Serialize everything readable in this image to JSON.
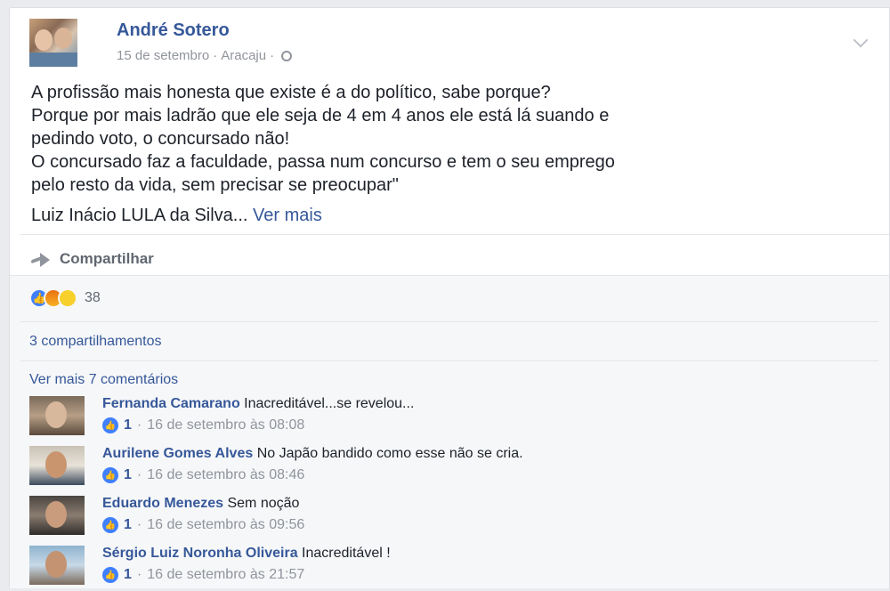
{
  "post": {
    "author": "André Sotero",
    "date": "15 de setembro",
    "location": "Aracaju",
    "separator": "·",
    "lines": [
      "A profissão mais honesta que existe é a do político, sabe porque?",
      "Porque por mais ladrão que ele seja de 4 em 4 anos ele está lá suando e",
      "pedindo voto, o concursado não!",
      "O concursado faz a faculdade, passa num concurso e tem o seu emprego",
      "pelo resto da vida, sem precisar se preocupar\""
    ],
    "signature": "Luiz Inácio LULA da Silva...",
    "see_more": "Ver mais"
  },
  "actions": {
    "share_label": "Compartilhar"
  },
  "feedback": {
    "reaction_count": "38",
    "reaction_icons": [
      "like-icon",
      "angry-icon",
      "wow-icon"
    ],
    "shares_label": "3 compartilhamentos",
    "more_comments_label": "Ver mais 7 comentários"
  },
  "comments": [
    {
      "author": "Fernanda Camarano",
      "text": "Inacreditável...se revelou...",
      "likes": "1",
      "meta": "16 de setembro às 08:08"
    },
    {
      "author": "Aurilene Gomes Alves",
      "text": "No Japão bandido como esse não se cria.",
      "likes": "1",
      "meta": "16 de setembro às 08:46"
    },
    {
      "author": "Eduardo Menezes",
      "text": "Sem noção",
      "likes": "1",
      "meta": "16 de setembro às 09:56"
    },
    {
      "author": "Sérgio Luiz Noronha Oliveira",
      "text": "Inacreditável !",
      "likes": "1",
      "meta": "16 de setembro às 21:57"
    }
  ],
  "colors": {
    "link": "#365899",
    "meta_gray": "#90949c",
    "like_blue": "#4080ff",
    "background": "#e9ebee"
  }
}
